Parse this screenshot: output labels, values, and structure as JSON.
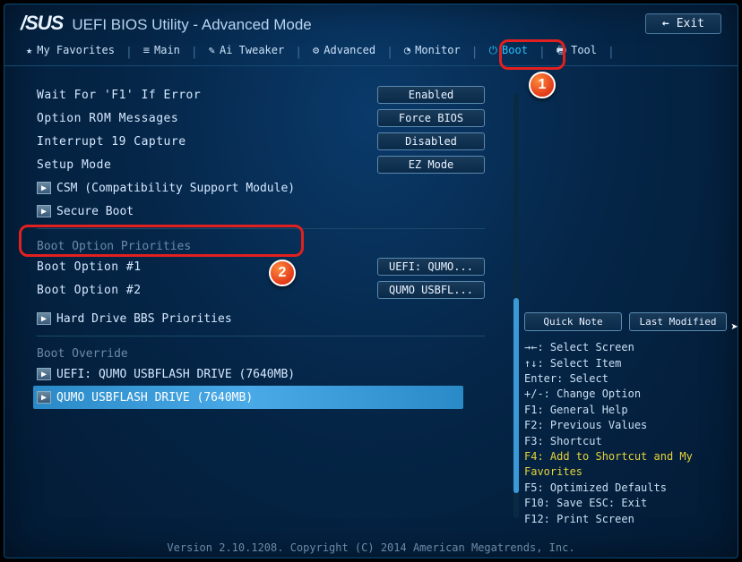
{
  "brand": "/SUS",
  "title": "UEFI BIOS Utility - Advanced Mode",
  "exit": "Exit",
  "tabs": [
    {
      "label": "My Favorites",
      "icon": "★"
    },
    {
      "label": "Main",
      "icon": "≡"
    },
    {
      "label": "Ai Tweaker",
      "icon": "✎"
    },
    {
      "label": "Advanced",
      "icon": "⚙"
    },
    {
      "label": "Monitor",
      "icon": "◔"
    },
    {
      "label": "Boot",
      "icon": "⏻",
      "active": true
    },
    {
      "label": "Tool",
      "icon": "🖶"
    }
  ],
  "settings": {
    "wait_f1": {
      "label": "Wait For 'F1' If Error",
      "value": "Enabled"
    },
    "option_rom": {
      "label": "Option ROM Messages",
      "value": "Force BIOS"
    },
    "int19": {
      "label": "Interrupt 19 Capture",
      "value": "Disabled"
    },
    "setup_mode": {
      "label": "Setup Mode",
      "value": "EZ Mode"
    },
    "csm": "CSM (Compatibility Support Module)",
    "secure_boot": "Secure Boot"
  },
  "boot_priorities": {
    "title": "Boot Option Priorities",
    "opt1": {
      "label": "Boot Option #1",
      "value": "UEFI: QUMO..."
    },
    "opt2": {
      "label": "Boot Option #2",
      "value": "QUMO USBFL..."
    },
    "hdd_bbs": "Hard Drive BBS Priorities"
  },
  "boot_override": {
    "title": "Boot Override",
    "items": [
      "UEFI: QUMO USBFLASH DRIVE (7640MB)",
      "QUMO USBFLASH DRIVE  (7640MB)"
    ]
  },
  "side_buttons": {
    "quick_note": "Quick Note",
    "last_modified": "Last Modified"
  },
  "help_keys": [
    "→←: Select Screen",
    "↑↓: Select Item",
    "Enter: Select",
    "+/-: Change Option",
    "F1: General Help",
    "F2: Previous Values",
    "F3: Shortcut",
    "F4: Add to Shortcut and My Favorites",
    "F5: Optimized Defaults",
    "F10: Save  ESC: Exit",
    "F12: Print Screen"
  ],
  "footer": "Version 2.10.1208. Copyright (C) 2014 American Megatrends, Inc.",
  "callouts": {
    "c1": "1",
    "c2": "2"
  }
}
